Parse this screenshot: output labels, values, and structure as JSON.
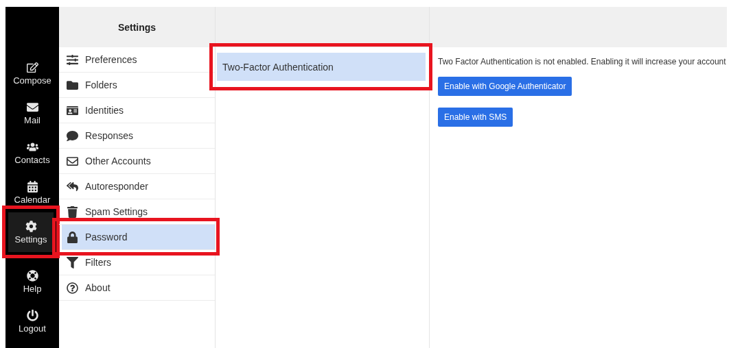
{
  "nav": [
    {
      "label": "Compose",
      "selected": false,
      "highlighted": false
    },
    {
      "label": "Mail",
      "selected": false,
      "highlighted": false
    },
    {
      "label": "Contacts",
      "selected": false,
      "highlighted": false
    },
    {
      "label": "Calendar",
      "selected": false,
      "highlighted": false
    },
    {
      "label": "Settings",
      "selected": true,
      "highlighted": true
    },
    {
      "label": "Help",
      "selected": false,
      "highlighted": false
    },
    {
      "label": "Logout",
      "selected": false,
      "highlighted": false
    }
  ],
  "settings": {
    "title": "Settings",
    "items": [
      {
        "label": "Preferences",
        "selected": false,
        "highlighted": false
      },
      {
        "label": "Folders",
        "selected": false,
        "highlighted": false
      },
      {
        "label": "Identities",
        "selected": false,
        "highlighted": false
      },
      {
        "label": "Responses",
        "selected": false,
        "highlighted": false
      },
      {
        "label": "Other Accounts",
        "selected": false,
        "highlighted": false
      },
      {
        "label": "Autoresponder",
        "selected": false,
        "highlighted": false
      },
      {
        "label": "Spam Settings",
        "selected": false,
        "highlighted": false
      },
      {
        "label": "Password",
        "selected": true,
        "highlighted": true
      },
      {
        "label": "Filters",
        "selected": false,
        "highlighted": false
      },
      {
        "label": "About",
        "selected": false,
        "highlighted": false
      }
    ]
  },
  "sections": [
    {
      "label": "Two-Factor Authentication",
      "selected": true,
      "highlighted": true
    }
  ],
  "detail": {
    "message": "Two Factor Authentication is not enabled. Enabling it will increase your account",
    "buttons": [
      "Enable with Google Authenticator",
      "Enable with SMS"
    ]
  }
}
